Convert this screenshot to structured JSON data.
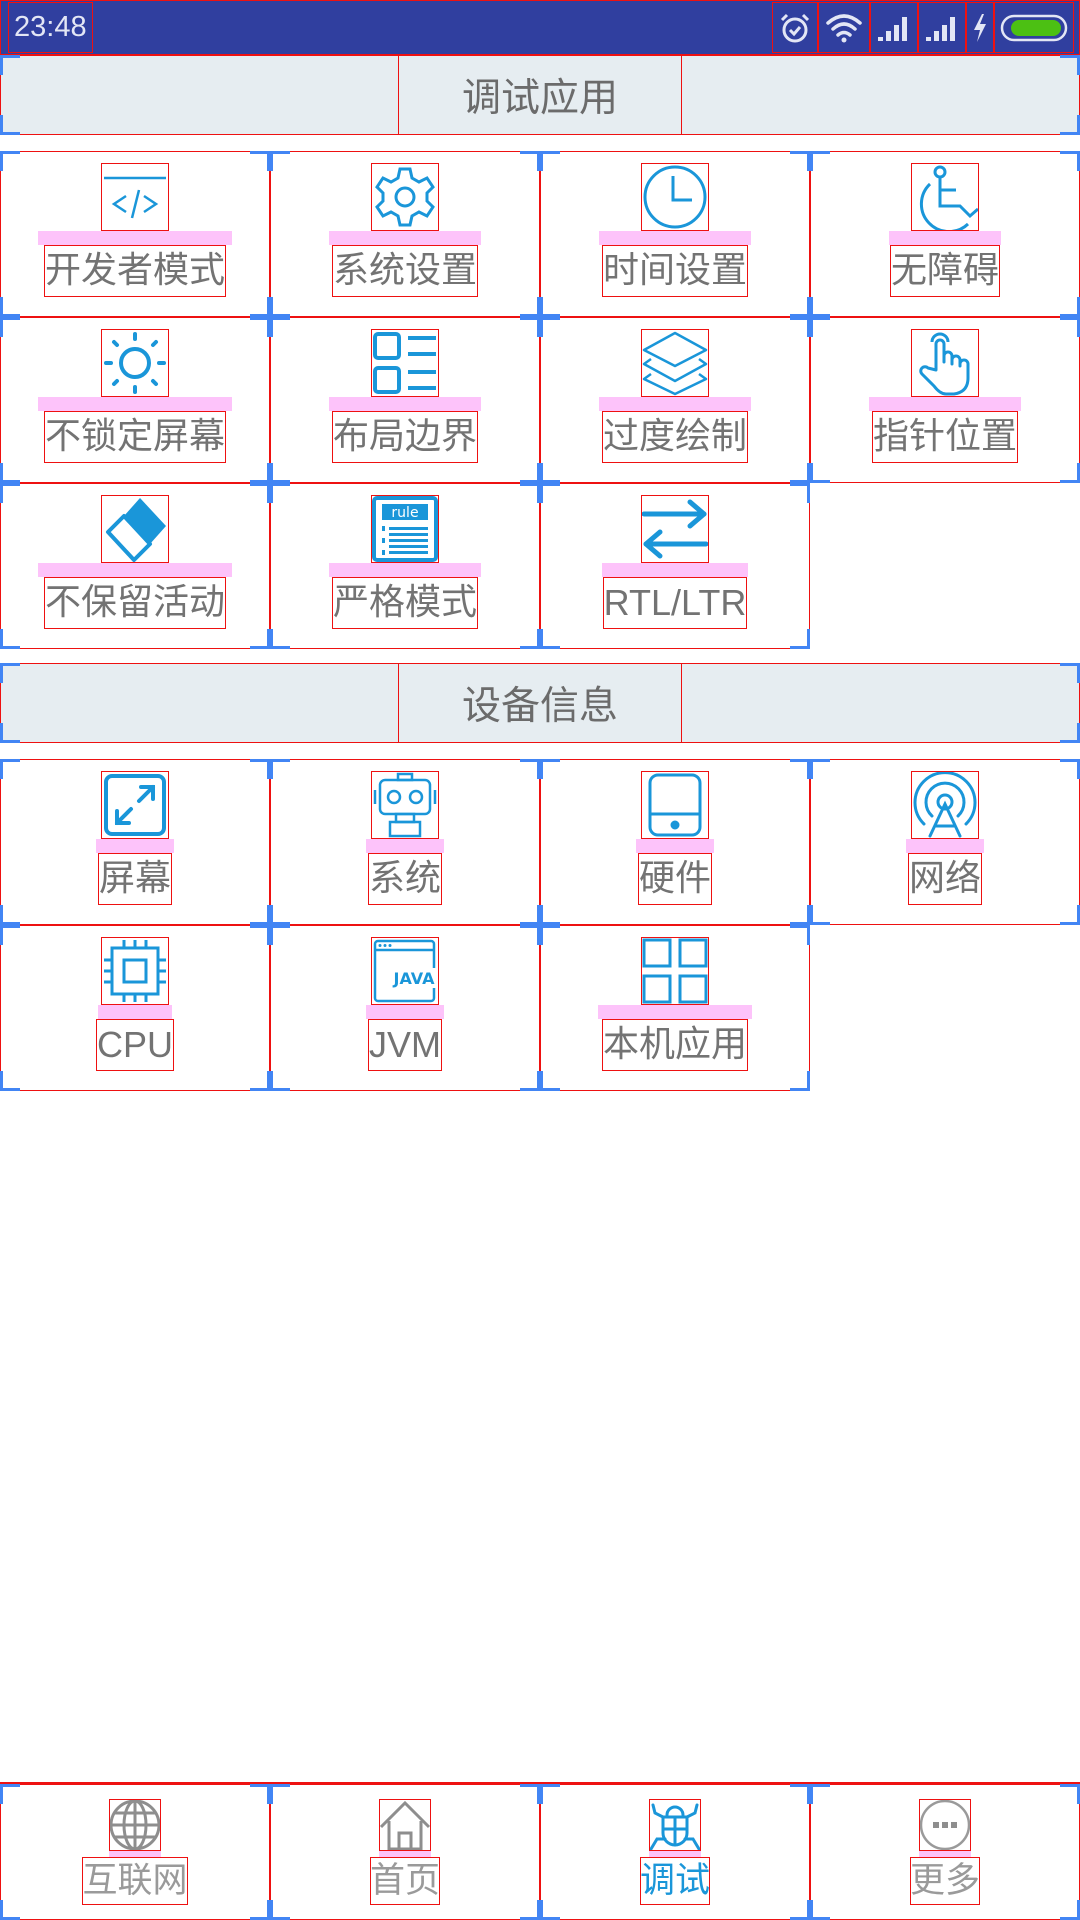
{
  "status_bar": {
    "time": "23:48",
    "icons": [
      "alarm-icon",
      "wifi-icon",
      "signal-icon",
      "signal-icon",
      "charging-icon",
      "battery-icon"
    ],
    "battery_color": "#4cc013"
  },
  "colors": {
    "accent": "#1a96d9",
    "status_bar_bg": "#303f9f",
    "section_bg": "#e6edf1",
    "label_text": "#737373",
    "nav_inactive": "#9a9a9a"
  },
  "sections": [
    {
      "title": "调试应用",
      "items": [
        {
          "label": "开发者模式",
          "icon": "code-window-icon"
        },
        {
          "label": "系统设置",
          "icon": "gear-icon"
        },
        {
          "label": "时间设置",
          "icon": "clock-icon"
        },
        {
          "label": "无障碍",
          "icon": "accessibility-icon"
        },
        {
          "label": "不锁定屏幕",
          "icon": "brightness-icon"
        },
        {
          "label": "布局边界",
          "icon": "layout-list-icon"
        },
        {
          "label": "过度绘制",
          "icon": "layers-icon"
        },
        {
          "label": "指针位置",
          "icon": "pointer-hand-icon"
        },
        {
          "label": "不保留活动",
          "icon": "eraser-icon"
        },
        {
          "label": "严格模式",
          "icon": "rule-document-icon"
        },
        {
          "label": "RTL/LTR",
          "icon": "swap-arrows-icon"
        }
      ]
    },
    {
      "title": "设备信息",
      "items": [
        {
          "label": "屏幕",
          "icon": "screen-expand-icon"
        },
        {
          "label": "系统",
          "icon": "robot-icon"
        },
        {
          "label": "硬件",
          "icon": "tablet-icon"
        },
        {
          "label": "网络",
          "icon": "antenna-icon"
        },
        {
          "label": "CPU",
          "icon": "cpu-chip-icon"
        },
        {
          "label": "JVM",
          "icon": "java-window-icon"
        },
        {
          "label": "本机应用",
          "icon": "app-grid-icon"
        }
      ]
    }
  ],
  "bottom_nav": {
    "active_index": 2,
    "items": [
      {
        "label": "互联网",
        "icon": "globe-icon"
      },
      {
        "label": "首页",
        "icon": "home-icon"
      },
      {
        "label": "调试",
        "icon": "bug-icon"
      },
      {
        "label": "更多",
        "icon": "more-icon"
      }
    ]
  }
}
